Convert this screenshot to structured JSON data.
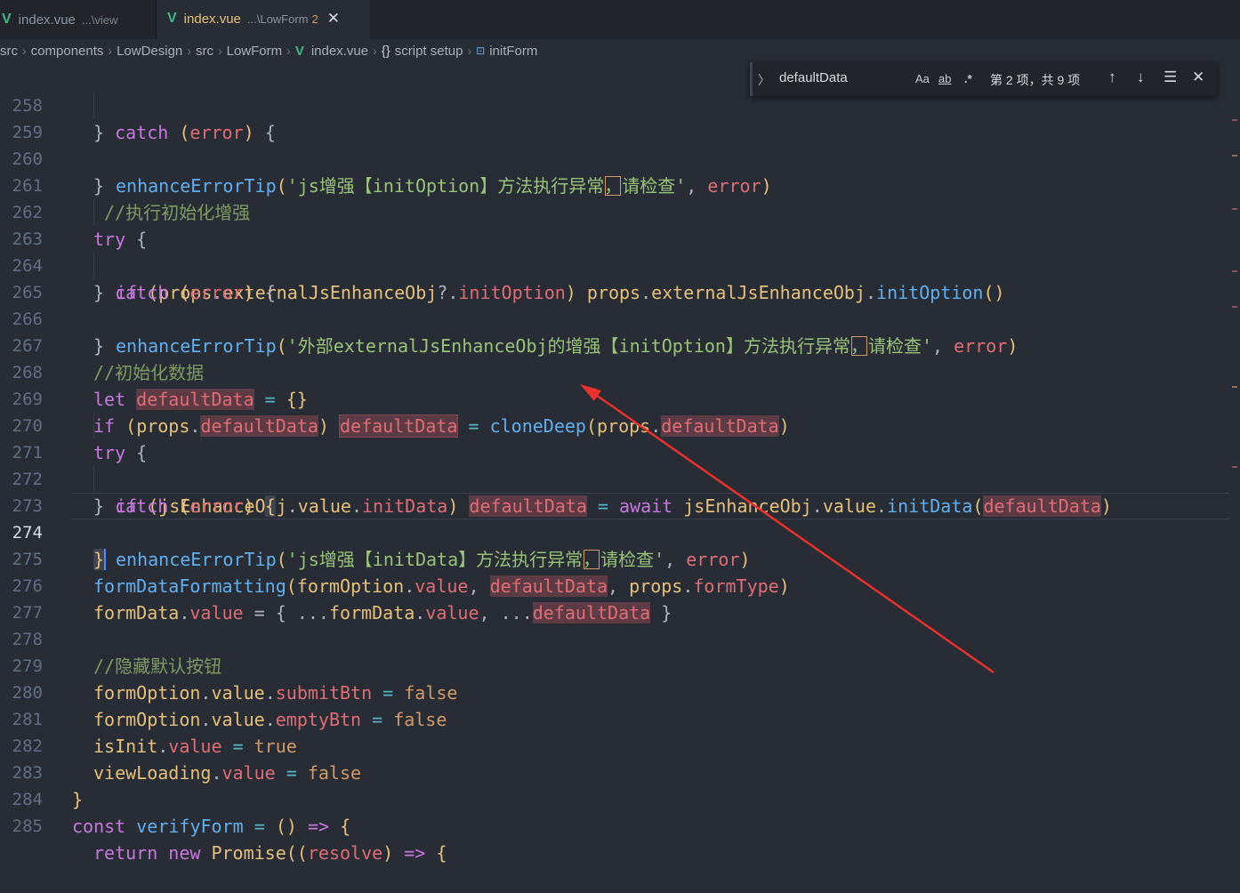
{
  "tabs": [
    {
      "name": "index.vue",
      "path": "...\\view",
      "active": false
    },
    {
      "name": "index.vue",
      "path": "...\\LowForm",
      "badge": "2",
      "active": true,
      "close": "✕"
    }
  ],
  "breadcrumb": [
    "src",
    "components",
    "LowDesign",
    "src",
    "LowForm",
    "index.vue",
    "script setup",
    "initForm"
  ],
  "find_widget": {
    "query": "defaultData",
    "match_case": "Aa",
    "whole_word": "ab",
    "regex": ".*",
    "result": "第 2 项，共 9 项"
  },
  "icons": {
    "vue": "vue-file-icon",
    "close": "close-icon",
    "braces": "braces-icon",
    "symbol": "method-symbol-icon",
    "expand": "chevron-right-icon",
    "prev": "arrow-up-icon",
    "next": "arrow-down-icon",
    "selection": "find-in-selection-icon",
    "find_close": "close-icon"
  },
  "current_line": 274,
  "lines": [
    {
      "n": "258"
    },
    {
      "n": "259"
    },
    {
      "n": "260"
    },
    {
      "n": "261"
    },
    {
      "n": "262"
    },
    {
      "n": "263"
    },
    {
      "n": "264"
    },
    {
      "n": "265"
    },
    {
      "n": "266"
    },
    {
      "n": "267"
    },
    {
      "n": "268"
    },
    {
      "n": "269"
    },
    {
      "n": "270"
    },
    {
      "n": "271"
    },
    {
      "n": "272"
    },
    {
      "n": "273"
    },
    {
      "n": "274"
    },
    {
      "n": "275"
    },
    {
      "n": "276"
    },
    {
      "n": "277"
    },
    {
      "n": "278"
    },
    {
      "n": "279"
    },
    {
      "n": "280"
    },
    {
      "n": "281"
    },
    {
      "n": "282"
    },
    {
      "n": "283"
    },
    {
      "n": "284"
    },
    {
      "n": "285"
    }
  ],
  "code": {
    "l258": [
      "} ",
      "catch",
      " ",
      "(",
      "error",
      ")",
      " {"
    ],
    "l259": [
      "enhanceErrorTip",
      "(",
      "'js增强【initOption】方法执行异常",
      "，",
      "请检查'",
      ", ",
      "error",
      ")"
    ],
    "l260": [
      "}"
    ],
    "l261": [
      "//执行初始化增强"
    ],
    "l262": [
      "try",
      " {"
    ],
    "l263": [
      "if",
      " (",
      "props",
      ".",
      "externalJsEnhanceObj",
      "?.",
      "initOption",
      ")",
      " ",
      "props",
      ".",
      "externalJsEnhanceObj",
      ".",
      "initOption",
      "()"
    ],
    "l264": [
      "} ",
      "catch",
      " ",
      "(",
      "error",
      ")",
      " {"
    ],
    "l265": [
      "enhanceErrorTip",
      "(",
      "'外部externalJsEnhanceObj的增强【initOption】方法执行异常",
      "，",
      "请检查'",
      ", ",
      "error",
      ")"
    ],
    "l266": [
      "}"
    ],
    "l267": [
      "//初始化数据"
    ],
    "l268": [
      "let",
      " ",
      "defaultData",
      " = ",
      "{}"
    ],
    "l269": [
      "if",
      " (",
      "props",
      ".",
      "defaultData",
      ")",
      " ",
      "defaultData",
      " = ",
      "cloneDeep",
      "(",
      "props",
      ".",
      "defaultData",
      ")"
    ],
    "l270": [
      "try",
      " {"
    ],
    "l271": [
      "if",
      " (",
      "jsEnhanceObj",
      ".",
      "value",
      ".",
      "initData",
      ")",
      " ",
      "defaultData",
      " = ",
      "await",
      " ",
      "jsEnhanceObj",
      ".",
      "value",
      ".",
      "initData",
      "(",
      "defaultData",
      ")"
    ],
    "l272": [
      "} ",
      "catch",
      " ",
      "(",
      "error",
      ")",
      " ",
      "{"
    ],
    "l273": [
      "enhanceErrorTip",
      "(",
      "'js增强【initData】方法执行异常",
      "，",
      "请检查'",
      ", ",
      "error",
      ")"
    ],
    "l274": [
      "}"
    ],
    "l275": [
      "formDataFormatting",
      "(",
      "formOption",
      ".",
      "value",
      ", ",
      "defaultData",
      ", ",
      "props",
      ".",
      "formType",
      ")"
    ],
    "l276": [
      "formData",
      ".",
      "value",
      " = { ",
      "...",
      "formData",
      ".",
      "value",
      ", ",
      "...",
      "defaultData",
      " }"
    ],
    "l277": [],
    "l278": [
      "//隐藏默认按钮"
    ],
    "l279": [
      "formOption",
      ".",
      "value",
      ".",
      "submitBtn",
      " = ",
      "false"
    ],
    "l280": [
      "formOption",
      ".",
      "value",
      ".",
      "emptyBtn",
      " = ",
      "false"
    ],
    "l281": [
      "isInit",
      ".",
      "value",
      " = ",
      "true"
    ],
    "l282": [
      "viewLoading",
      ".",
      "value",
      " = ",
      "false"
    ],
    "l283": [
      "}"
    ],
    "l284": [
      "const",
      " ",
      "verifyForm",
      " = ",
      "()",
      " ",
      "=>",
      " {"
    ],
    "l285": [
      "return",
      " ",
      "new",
      " ",
      "Promise",
      "((",
      "resolve",
      ")",
      " ",
      "=>",
      " {"
    ]
  },
  "annotation": {
    "color": "#e8312c"
  },
  "colors": {
    "background": "#282c34",
    "keyword": "#c678dd",
    "function": "#61afef",
    "string": "#98c379",
    "comment": "#7f9a63",
    "variable": "#e06c75",
    "property": "#e5c07b",
    "match_highlight": "#5c3b44"
  }
}
